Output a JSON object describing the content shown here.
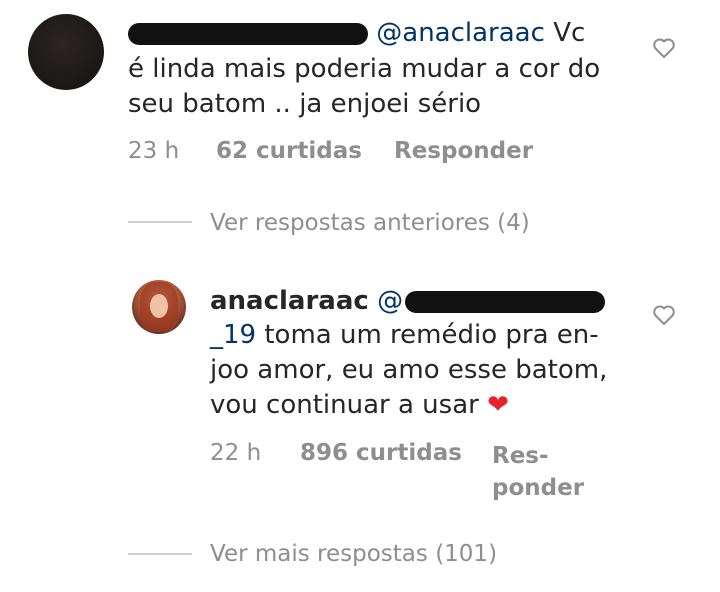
{
  "comment1": {
    "username": "",
    "mention": "@anaclaraac",
    "text_line1_end": "Vc",
    "text_line2": "é linda mais poderia mudar a cor do",
    "text_line3": "seu batom .. ja enjoei sério",
    "time": "23 h",
    "likes": "62 curtidas",
    "reply": "Responder"
  },
  "view_previous": "Ver respostas anteriores (4)",
  "reply1": {
    "username": "anaclaraac",
    "mention_start": "@",
    "mention_end": "_19",
    "text_line2_rest": "toma um remédio pra en-",
    "text_line3": "joo amor, eu amo esse batom,",
    "text_line4": "vou continuar a usar",
    "emoji": "❤",
    "time": "22 h",
    "likes": "896 curtidas",
    "reply_line1": "Res-",
    "reply_line2": "ponder"
  },
  "view_more": "Ver mais respostas (101)",
  "colors": {
    "text": "#262626",
    "mention": "#003569",
    "meta": "#8e8e8e",
    "heart_emoji": "#e8202a"
  },
  "icons": {
    "like": "heart-outline-icon"
  }
}
